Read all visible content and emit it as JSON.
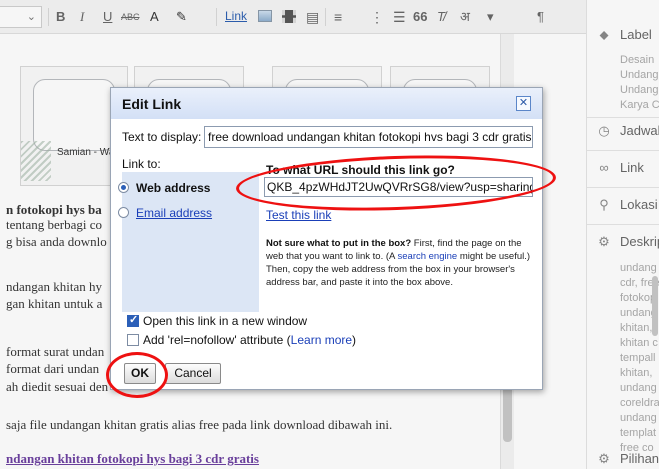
{
  "toolbar": {
    "font_size_value": "",
    "bold": "B",
    "italic": "I",
    "underline": "U",
    "strike": "ABC",
    "link": "Link",
    "quote": "66",
    "transliterate": "अ",
    "rtl": "¶"
  },
  "editor": {
    "card1_name": "Samian - Warti",
    "paragraphs": [
      "n fotokopi hys ba",
      "tentang berbagi co",
      "g bisa anda downlo",
      "ndangan khitan hy",
      "gan khitan untuk a",
      "format surat undan",
      "format dari undan",
      "ah diedit sesuai den",
      "saja file undangan khitan gratis alias free pada link download dibawah ini.",
      "ndangan khitan fotokopi hys bagi 3 cdr gratis"
    ]
  },
  "sidebar": {
    "label_heading": "Label",
    "label_lines": [
      "Desain",
      "Undang",
      "Undang",
      "Karya C"
    ],
    "schedule_heading": "Jadwal",
    "link_heading": "Link",
    "location_heading": "Lokasi",
    "description_heading": "Deskrip",
    "description_lines": [
      "undang",
      "cdr, free",
      "fotokop",
      "undang",
      "khitan,",
      "khitan c",
      "tempall",
      "khitan,",
      "undang",
      "coreldra",
      "undang",
      "templat",
      "free co"
    ],
    "options_heading": "Pilihan"
  },
  "dialog": {
    "title": "Edit Link",
    "text_to_display_label": "Text to display:",
    "text_to_display_value": "free download undangan khitan fotokopi hvs bagi 3 cdr gratis",
    "link_to_label": "Link to:",
    "option_web": "Web address",
    "option_email": "Email address",
    "url_question": "To what URL should this link go?",
    "url_value": "QKB_4pzWHdJT2UwQVRrSG8/view?usp=sharing",
    "test_link": "Test this link",
    "help_bold": "Not sure what to put in the box?",
    "help_text_1": " First, find the page on the web that you want to link to. (A ",
    "help_link": "search engine",
    "help_text_2": " might be useful.) Then, copy the web address from the box in your browser's address bar, and paste it into the box above.",
    "open_new_window_label": "Open this link in a new window",
    "nofollow_label_prefix": "Add 'rel=nofollow' attribute (",
    "learn_more": "Learn more",
    "nofollow_label_suffix": ")",
    "ok_label": "OK",
    "cancel_label": "Cancel",
    "close_glyph": "✕",
    "web_selected": true,
    "open_new_window_checked": true,
    "nofollow_checked": false
  },
  "colors": {
    "annotation_red": "#e11111",
    "dialog_title_bg": "#d3e0f6",
    "link_blue": "#1a3fb8"
  }
}
